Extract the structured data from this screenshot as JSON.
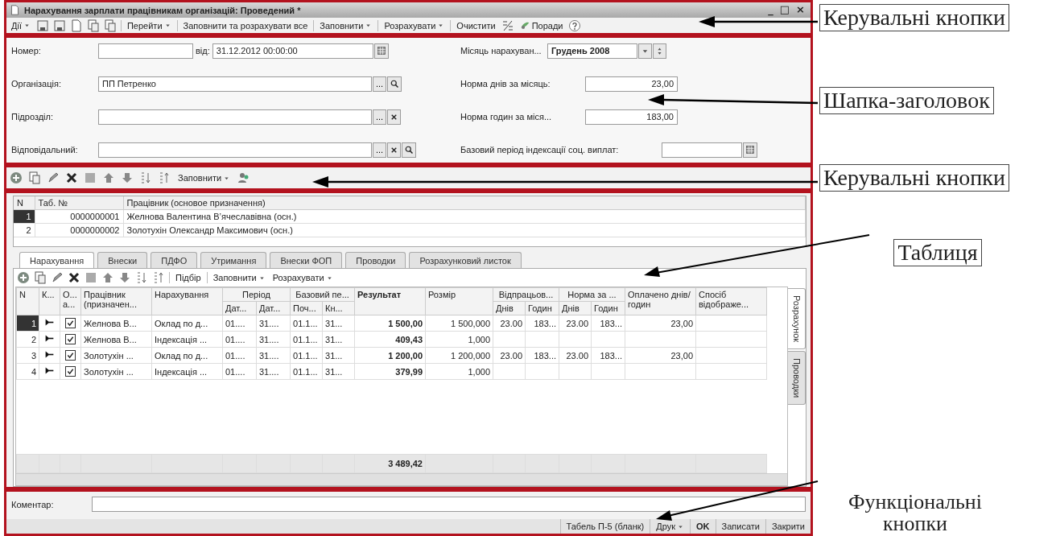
{
  "window": {
    "title": "Нарахування зарплати працівникам організацій: Проведений *",
    "controls": [
      "_",
      "□",
      "×"
    ]
  },
  "toolbar": {
    "actions": [
      {
        "label": "Дії",
        "dropdown": true
      },
      {
        "label": "Перейти",
        "dropdown": true
      },
      {
        "label": "Заповнити та розрахувати все",
        "dropdown": false
      },
      {
        "label": "Заповнити",
        "dropdown": true
      },
      {
        "label": "Розрахувати",
        "dropdown": true
      },
      {
        "label": "Очистити",
        "dropdown": false
      }
    ],
    "hint": "Поради"
  },
  "header": {
    "number": {
      "label": "Номер:"
    },
    "date": {
      "label": "від:",
      "value": "31.12.2012 00:00:00"
    },
    "fields": [
      {
        "label": "Організація:",
        "value": "ПП Петренко",
        "buttons": [
          {
            "kind": "choose",
            "text": "..."
          },
          {
            "kind": "search"
          }
        ]
      },
      {
        "label": "Підрозділ:",
        "buttons": [
          {
            "kind": "choose",
            "text": "..."
          },
          {
            "kind": "clear"
          }
        ]
      },
      {
        "label": "Відповідальний:",
        "buttons": [
          {
            "kind": "choose",
            "text": "..."
          },
          {
            "kind": "clear"
          },
          {
            "kind": "search"
          }
        ]
      }
    ],
    "month": {
      "label": "Місяць нарахуван...",
      "value": "Грудень 2008"
    },
    "norms": [
      {
        "label": "Норма днів за місяць:",
        "value": "23,00"
      },
      {
        "label": "Норма годин за міся...",
        "value": "183,00"
      }
    ],
    "base_period": {
      "label": "Базовий період індексації соц. виплат:"
    }
  },
  "table_toolbar": {
    "fill": "Заповнити"
  },
  "employees": {
    "columns": [
      "N",
      "Таб. №",
      "Працівник (основое призначення)"
    ],
    "rows": [
      {
        "n": "1",
        "tab_no": "0000000001",
        "name": "Желнова Валентина В’ячеславівна (осн.)",
        "selected": true
      },
      {
        "n": "2",
        "tab_no": "0000000002",
        "name": "Золотухін Олександр Максимович (осн.)",
        "selected": false
      }
    ]
  },
  "tabs": [
    {
      "label": "Нарахування",
      "selected": true
    },
    {
      "label": "Внески",
      "selected": false
    },
    {
      "label": "ПДФО",
      "selected": false
    },
    {
      "label": "Утримання",
      "selected": false
    },
    {
      "label": "Внески ФОП",
      "selected": false
    },
    {
      "label": "Проводки",
      "selected": false
    },
    {
      "label": "Розрахунковий листок",
      "selected": false
    }
  ],
  "grid_toolbar": {
    "pick": "Підбір",
    "fill": "Заповнити",
    "calculate": "Розрахувати"
  },
  "grid": {
    "columns": [
      {
        "label": "N"
      },
      {
        "label": "К..."
      },
      {
        "label": "О... а..."
      },
      {
        "label": "Працівник (призначен..."
      },
      {
        "label": "Нарахування"
      },
      {
        "label": "Період",
        "sub": [
          "Дат...",
          "Дат..."
        ]
      },
      {
        "label": "Базовий пе...",
        "sub": [
          "Поч...",
          "Кн..."
        ]
      },
      {
        "label": "Результат",
        "bold": true
      },
      {
        "label": "Розмір"
      },
      {
        "label": "Відпрацьов...",
        "sub": [
          "Днів",
          "Годин"
        ]
      },
      {
        "label": "Норма за ...",
        "sub": [
          "Днів",
          "Годин"
        ]
      },
      {
        "label": "Оплачено днів/годин"
      },
      {
        "label": "Спосіб відображе..."
      }
    ],
    "rows": [
      {
        "n": "1",
        "selected": true,
        "included": true,
        "employee": "Желнова В...",
        "accrual": "Оклад по д...",
        "from": "01....",
        "to": "31....",
        "base_from": "01.1...",
        "base_to": "31...",
        "result": "1 500,00",
        "size": "1 500,000",
        "worked_days": "23.00",
        "worked_hours": "183...",
        "norm_days": "23.00",
        "norm_hours": "183...",
        "paid": "23,00"
      },
      {
        "n": "2",
        "selected": false,
        "included": true,
        "employee": "Желнова В...",
        "accrual": "Індексація ...",
        "from": "01....",
        "to": "31....",
        "base_from": "01.1...",
        "base_to": "31...",
        "result": "409,43",
        "size": "1,000"
      },
      {
        "n": "3",
        "selected": false,
        "included": true,
        "employee": "Золотухін ...",
        "accrual": "Оклад по д...",
        "from": "01....",
        "to": "31....",
        "base_from": "01.1...",
        "base_to": "31...",
        "result": "1 200,00",
        "size": "1 200,000",
        "worked_days": "23.00",
        "worked_hours": "183...",
        "norm_days": "23.00",
        "norm_hours": "183...",
        "paid": "23,00"
      },
      {
        "n": "4",
        "selected": false,
        "included": true,
        "employee": "Золотухін ...",
        "accrual": "Індексація ...",
        "from": "01....",
        "to": "31....",
        "base_from": "01.1...",
        "base_to": "31...",
        "result": "379,99",
        "size": "1,000"
      }
    ],
    "totals": {
      "result": "3 489,42"
    }
  },
  "side_tabs": [
    {
      "label": "Розрахунок",
      "selected": true
    },
    {
      "label": "Проводки",
      "selected": false
    }
  ],
  "footer": {
    "comment_label": "Коментар:",
    "buttons": [
      {
        "label": "Табель П-5 (бланк)",
        "dropdown": false,
        "bold": false
      },
      {
        "label": "Друк",
        "dropdown": true,
        "bold": false
      },
      {
        "label": "OK",
        "dropdown": false,
        "bold": true
      },
      {
        "label": "Записати",
        "dropdown": false,
        "bold": false
      },
      {
        "label": "Закрити",
        "dropdown": false,
        "bold": false
      }
    ]
  },
  "annotations": [
    "Керувальні кнопки",
    "Шапка-заголовок",
    "Керувальні кнопки",
    "Таблиця",
    "Функціональні кнопки"
  ]
}
